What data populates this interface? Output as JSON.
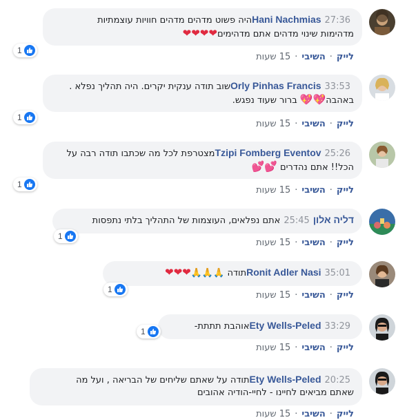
{
  "actions": {
    "like": "לייק",
    "reply": "השיבי",
    "time": "15 שעות"
  },
  "comments": [
    {
      "name": "Hani Nachmias",
      "time": "27:36",
      "text": "היה פשוט מדהים מדהים חוויות עוצמתיות",
      "text2": "מדהימות שינוי מדהים אתם מדהימים",
      "hearts2": "❤❤❤❤",
      "reactions": "1"
    },
    {
      "name": "Orly Pinhas Francis",
      "time": "33:53",
      "text": "שוב תודה ענקית יקרים. היה תהליך נפלא .",
      "text2": "באהבה",
      "hearts2": "💖💖",
      "text2b": "ברור שעוד נפגש.",
      "reactions": "1"
    },
    {
      "name": "Tzipi Fomberg Eventov",
      "time": "25:26",
      "text": "מצטרפת לכל מה שכתבו תודה רבה על",
      "text2": "הכל!! אתם נהדרים",
      "hearts2": "💕💕",
      "reactions": "1"
    },
    {
      "name": "דליה אלון",
      "time": "25:45",
      "text": "אתם נפלאים, העוצמות של התהליך בלתי נתפסות",
      "reactions": "1"
    },
    {
      "name": "Ronit Adler Nasi",
      "time": "35:01",
      "text": "תודה",
      "emoji": "🙏🙏🙏",
      "hearts": "❤❤❤",
      "reactions": "1"
    },
    {
      "name": "Ety Wells-Peled",
      "time": "33:29",
      "text": "אוהבת תתתת-",
      "reactions": "1"
    },
    {
      "name": "Ety Wells-Peled",
      "time": "20:25",
      "text": "תודה על שאתם שליחים של הבריאה , ועל מה",
      "text2": "שאתם מביאים לחיינו - לחיי-הודיה אהובים"
    }
  ]
}
